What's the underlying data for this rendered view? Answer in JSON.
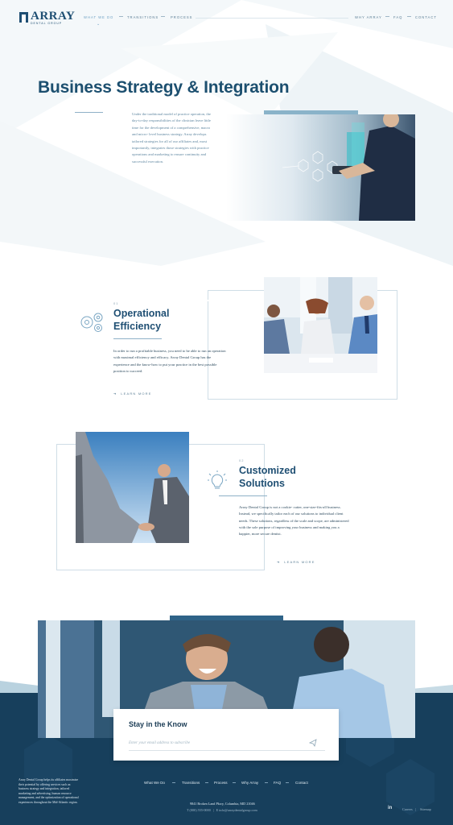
{
  "brand": {
    "name": "ARRAY",
    "sub": "DENTAL GROUP",
    "colors": {
      "primary": "#1f4f73",
      "accent": "#8ab3c9",
      "footer": "#173f5c"
    }
  },
  "nav": {
    "items": [
      "WHAT WE DO",
      "TRANSITIONS",
      "PROCESS"
    ],
    "right_items": [
      "WHY ARRAY",
      "FAQ",
      "CONTACT"
    ],
    "active": "WHAT WE DO"
  },
  "hero": {
    "title": "Business Strategy & Integration",
    "text": "Under the traditional model of practice operation, the day-to-day responsibilities of the clinician leave little time for the development of a comprehensive, macro and micro- level business strategy. Array develops tailored strategies for all of our affiliates and, most importantly, integrates those strategies with practice operations and marketing to ensure continuity and successful execution.",
    "image": "businessman with tablet and digital interface"
  },
  "sections": [
    {
      "number": "01",
      "icon": "gears-icon",
      "title_line1": "Operational",
      "title_line2": "Efficiency",
      "text": "In order to run a profitable business, you need to be able to run an operation with maximal efficiency and efficacy. Array Dental Group has the experience and the know-how to put your practice in the best possible position to succeed.",
      "learn_more": "LEARN MORE",
      "image": "team meeting at office desk"
    },
    {
      "number": "02",
      "icon": "lightbulb-icon",
      "title_line1": "Customized",
      "title_line2": "Solutions",
      "text": "Array Dental Group is not a cookie- cutter, one-size-fits-all business. Instead, we specifically tailor each of our solutions to individual client needs. These solutions, regardless of the scale and scope, are administered with the sole purpose of improving your business and making you a happier, more secure dentist.",
      "learn_more": "LEARN MORE",
      "image": "businessmen handshake against sky"
    }
  ],
  "newsletter": {
    "title": "Stay in the Know",
    "placeholder": "Enter your email address to subscribe",
    "image": "smiling man in meeting"
  },
  "footer": {
    "about": "Array Dental Group helps its affiliates maximize their potential by offering services such as: business strategy and integration, tailored marketing and advertising, human resource management, and the optimization of operational experiences throughout the Mid-Atlantic region.",
    "nav": [
      "What We Do",
      "Transitions",
      "Process",
      "Why Array",
      "FAQ",
      "Contact"
    ],
    "address": "9841 Broken Land Pkwy, Columbia, MD 21046",
    "phone_prefix": "T",
    "phone": "(000) 555-0000",
    "email_prefix": "E",
    "email": "info@arraydentalgroup.com",
    "careers": "Careers",
    "sitemap": "Sitemap",
    "social": "linkedin-icon"
  }
}
